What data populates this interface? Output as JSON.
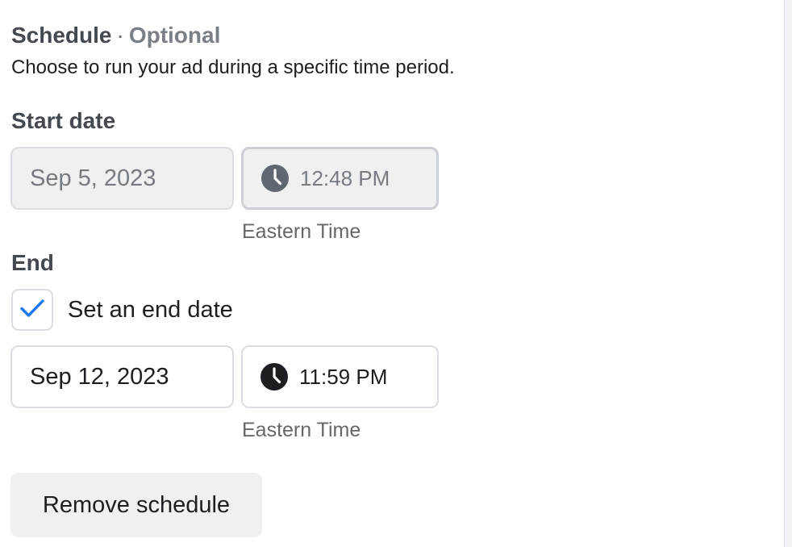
{
  "schedule": {
    "title": "Schedule",
    "separator": "·",
    "optional_label": "Optional",
    "description": "Choose to run your ad during a specific time period."
  },
  "start": {
    "label": "Start date",
    "date_value": "Sep 5, 2023",
    "time_value": "12:48 PM",
    "timezone": "Eastern Time"
  },
  "end": {
    "label": "End",
    "checkbox_label": "Set an end date",
    "checkbox_checked": true,
    "date_value": "Sep 12, 2023",
    "time_value": "11:59 PM",
    "timezone": "Eastern Time"
  },
  "actions": {
    "remove_schedule_label": "Remove schedule"
  },
  "colors": {
    "check_accent": "#1877f2",
    "disabled_icon": "#606770",
    "enabled_icon": "#1c1e21"
  },
  "icons": {
    "time_icon": "clock-icon",
    "checkmark_icon": "checkmark-icon"
  }
}
